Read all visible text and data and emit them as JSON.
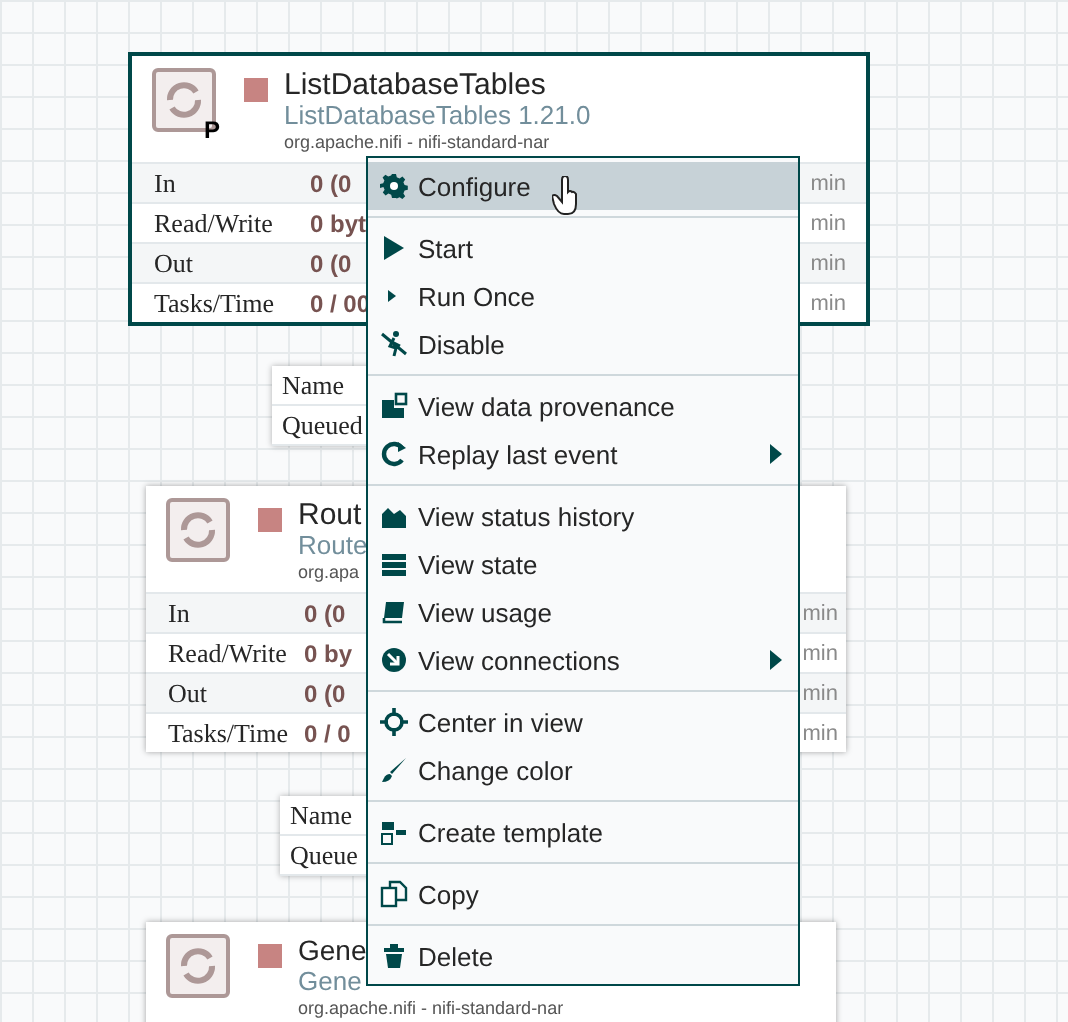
{
  "processors": [
    {
      "title": "ListDatabaseTables",
      "subtitle": "ListDatabaseTables 1.21.0",
      "bundle": "org.apache.nifi - nifi-standard-nar",
      "badge": "P",
      "selected": true,
      "stats": [
        {
          "label": "In",
          "value": "0 (0",
          "tail": "min"
        },
        {
          "label": "Read/Write",
          "value": "0 byt",
          "tail": "min"
        },
        {
          "label": "Out",
          "value": "0 (0",
          "tail": "min"
        },
        {
          "label": "Tasks/Time",
          "value": "0 / 00",
          "tail": "min"
        }
      ]
    },
    {
      "title": "Rout",
      "subtitle": "Route",
      "bundle": "org.apa",
      "selected": false,
      "stats": [
        {
          "label": "In",
          "value": "0 (0",
          "tail": "min"
        },
        {
          "label": "Read/Write",
          "value": "0 by",
          "tail": "min"
        },
        {
          "label": "Out",
          "value": "0 (0",
          "tail": "min"
        },
        {
          "label": "Tasks/Time",
          "value": "0 / 0",
          "tail": "min"
        }
      ]
    },
    {
      "title": "Gene",
      "subtitle": "Gene",
      "bundle": "org.apache.nifi - nifi-standard-nar",
      "selected": false
    }
  ],
  "connections": [
    {
      "name_label": "Name",
      "queued_label": "Queued"
    },
    {
      "name_label": "Name",
      "queued_label": "Queue"
    }
  ],
  "context_menu": [
    {
      "kind": "item",
      "label": "Configure",
      "selected": true
    },
    {
      "kind": "separator"
    },
    {
      "kind": "item",
      "label": "Start",
      "selected": false
    },
    {
      "kind": "item",
      "label": "Run Once",
      "selected": false
    },
    {
      "kind": "item",
      "label": "Disable",
      "selected": false
    },
    {
      "kind": "separator"
    },
    {
      "kind": "item",
      "label": "View data provenance",
      "selected": false
    },
    {
      "kind": "item",
      "label": "Replay last event",
      "selected": false,
      "submenu": true
    },
    {
      "kind": "separator"
    },
    {
      "kind": "item",
      "label": "View status history",
      "selected": false
    },
    {
      "kind": "item",
      "label": "View state",
      "selected": false
    },
    {
      "kind": "item",
      "label": "View usage",
      "selected": false
    },
    {
      "kind": "item",
      "label": "View connections",
      "selected": false,
      "submenu": true
    },
    {
      "kind": "separator"
    },
    {
      "kind": "item",
      "label": "Center in view",
      "selected": false
    },
    {
      "kind": "item",
      "label": "Change color",
      "selected": false
    },
    {
      "kind": "separator"
    },
    {
      "kind": "item",
      "label": "Create template",
      "selected": false
    },
    {
      "kind": "separator"
    },
    {
      "kind": "item",
      "label": "Copy",
      "selected": false
    },
    {
      "kind": "separator"
    },
    {
      "kind": "item",
      "label": "Delete",
      "selected": false
    }
  ]
}
